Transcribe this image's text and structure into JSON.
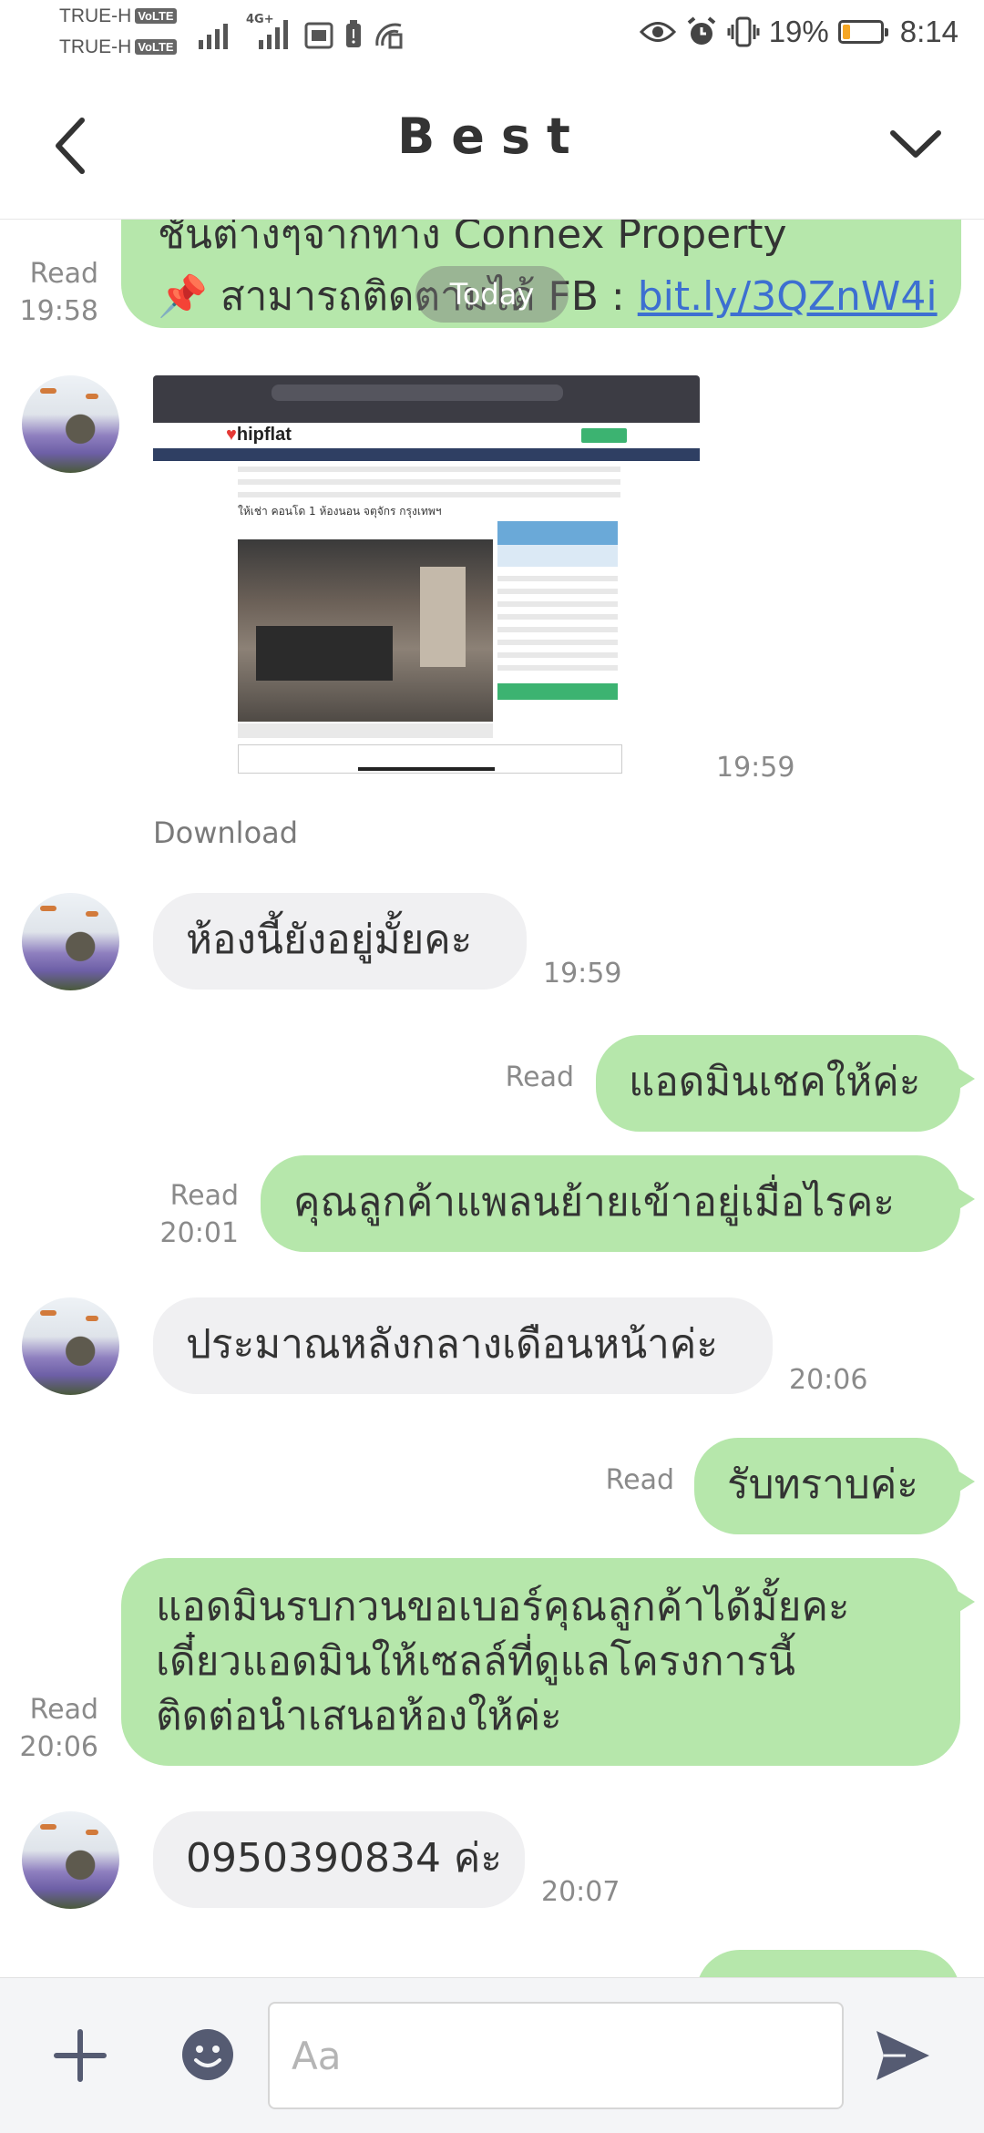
{
  "status_bar": {
    "carrier1": "TRUE-H",
    "carrier2": "TRUE-H",
    "volte": "VoLTE",
    "network": "4G+",
    "battery_percent": "19%",
    "battery_level": 0.19,
    "time": "8:14",
    "icons": [
      "signal-icon",
      "sim-icon",
      "battery-saver-icon",
      "hotspot-icon",
      "eye-icon",
      "alarm-icon",
      "vibrate-icon"
    ]
  },
  "header": {
    "title": "Best",
    "back_icon": "chevron-left-icon",
    "menu_icon": "chevron-down-icon"
  },
  "date_divider": "Today",
  "messages": [
    {
      "id": "m0",
      "direction": "out",
      "line1": "ชั้นต่างๆจากทาง Connex Property",
      "line2_prefix": "📌 สามารถติดตามได้ FB : ",
      "link": "bit.ly/3QZnW4i",
      "status": "Read",
      "time": "19:58"
    },
    {
      "id": "m1",
      "direction": "in",
      "type": "image",
      "image_logo": "hipflat",
      "image_heading": "ให้เช่า คอนโด 1 ห้องนอน จตุจักร กรุงเทพฯ",
      "time": "19:59",
      "download": "Download"
    },
    {
      "id": "m2",
      "direction": "in",
      "text": "ห้องนี้ยังอยู่มั้ยคะ",
      "time": "19:59"
    },
    {
      "id": "m3",
      "direction": "out",
      "text": "แอดมินเชคให้ค่ะ",
      "status": "Read"
    },
    {
      "id": "m4",
      "direction": "out",
      "text": "คุณลูกค้าแพลนย้ายเข้าอยู่เมื่อไรคะ",
      "status": "Read",
      "time": "20:01"
    },
    {
      "id": "m5",
      "direction": "in",
      "text": "ประมาณหลังกลางเดือนหน้าค่ะ",
      "time": "20:06"
    },
    {
      "id": "m6",
      "direction": "out",
      "text": "รับทราบค่ะ",
      "status": "Read"
    },
    {
      "id": "m7",
      "direction": "out",
      "lines": [
        "แอดมินรบกวนขอเบอร์คุณลูกค้าได้มั้ยคะ",
        "เดี๋ยวแอดมินให้เซลล์ที่ดูแลโครงการนี้",
        "ติดต่อนำเสนอห้องให้ค่ะ"
      ],
      "status": "Read",
      "time": "20:06"
    },
    {
      "id": "m8",
      "direction": "in",
      "text": "0950390834 ค่ะ",
      "time": "20:07"
    }
  ],
  "composer": {
    "placeholder": "Aa",
    "plus_icon": "plus-icon",
    "emoji_icon": "smiley-icon",
    "send_icon": "send-icon"
  },
  "colors": {
    "outgoing_bubble": "#b6e7ab",
    "incoming_bubble": "#f0f0f2",
    "link": "#3d6fd1",
    "battery_fill": "#f5a623"
  }
}
